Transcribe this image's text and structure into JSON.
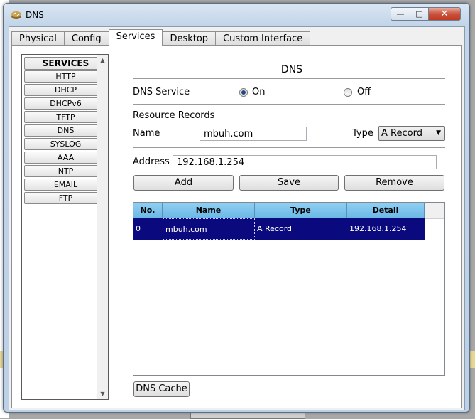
{
  "window": {
    "title": "DNS"
  },
  "tabs": [
    "Physical",
    "Config",
    "Services",
    "Desktop",
    "Custom Interface"
  ],
  "active_tab": "Services",
  "services": {
    "header": "SERVICES",
    "items": [
      "HTTP",
      "DHCP",
      "DHCPv6",
      "TFTP",
      "DNS",
      "SYSLOG",
      "AAA",
      "NTP",
      "EMAIL",
      "FTP"
    ]
  },
  "dns": {
    "heading": "DNS",
    "service_label": "DNS Service",
    "on_label": "On",
    "off_label": "Off",
    "service_state": "On",
    "resource_records_label": "Resource Records",
    "name_label": "Name",
    "name_value": "mbuh.com",
    "type_label": "Type",
    "type_value": "A Record",
    "address_label": "Address",
    "address_value": "192.168.1.254",
    "add_label": "Add",
    "save_label": "Save",
    "remove_label": "Remove",
    "table": {
      "columns": [
        "No.",
        "Name",
        "Type",
        "Detail"
      ],
      "rows": [
        [
          "0",
          "mbuh.com",
          "A Record",
          "192.168.1.254"
        ]
      ]
    },
    "cache_label": "DNS Cache"
  },
  "colors": {
    "selected_row": "#0a0a7e",
    "header_blue": "#7cc2ec",
    "close_red": "#c9523d"
  }
}
